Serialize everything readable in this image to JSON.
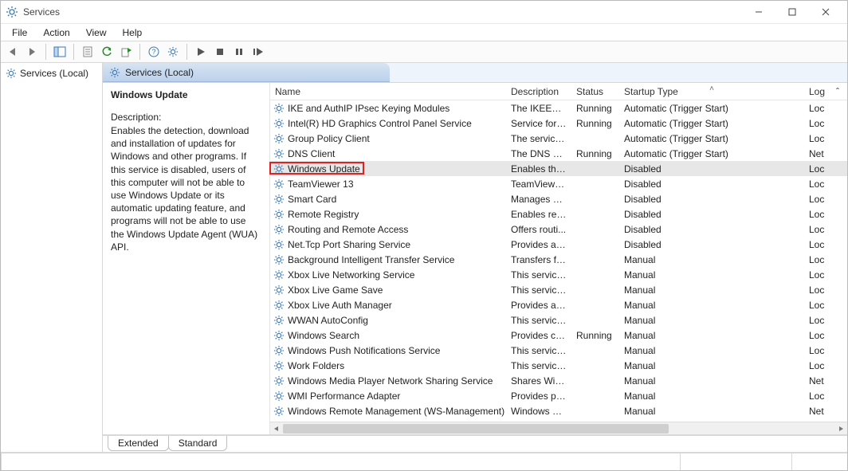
{
  "window": {
    "title": "Services",
    "controls": {
      "min": "—",
      "max": "▢",
      "close": "✕"
    }
  },
  "menus": [
    "File",
    "Action",
    "View",
    "Help"
  ],
  "left_tree": {
    "root_label": "Services (Local)"
  },
  "pane_header": "Services (Local)",
  "detail": {
    "title": "Windows Update",
    "desc_label": "Description:",
    "description": "Enables the detection, download and installation of updates for Windows and other programs. If this service is disabled, users of this computer will not be able to use Windows Update or its automatic updating feature, and programs will not be able to use the Windows Update Agent (WUA) API."
  },
  "columns": {
    "name": "Name",
    "description": "Description",
    "status": "Status",
    "startup": "Startup Type",
    "log": "Log"
  },
  "sort_indicator": "˄",
  "services": [
    {
      "name": "IKE and AuthIP IPsec Keying Modules",
      "desc": "The IKEEXT ...",
      "status": "Running",
      "startup": "Automatic (Trigger Start)",
      "log": "Loc"
    },
    {
      "name": "Intel(R) HD Graphics Control Panel Service",
      "desc": "Service for I...",
      "status": "Running",
      "startup": "Automatic (Trigger Start)",
      "log": "Loc"
    },
    {
      "name": "Group Policy Client",
      "desc": "The service ...",
      "status": "",
      "startup": "Automatic (Trigger Start)",
      "log": "Loc"
    },
    {
      "name": "DNS Client",
      "desc": "The DNS Cli...",
      "status": "Running",
      "startup": "Automatic (Trigger Start)",
      "log": "Net"
    },
    {
      "name": "Windows Update",
      "desc": "Enables the ...",
      "status": "",
      "startup": "Disabled",
      "log": "Loc",
      "selected": true,
      "highlighted": true
    },
    {
      "name": "TeamViewer 13",
      "desc": "TeamViewer...",
      "status": "",
      "startup": "Disabled",
      "log": "Loc"
    },
    {
      "name": "Smart Card",
      "desc": "Manages ac...",
      "status": "",
      "startup": "Disabled",
      "log": "Loc"
    },
    {
      "name": "Remote Registry",
      "desc": "Enables rem...",
      "status": "",
      "startup": "Disabled",
      "log": "Loc"
    },
    {
      "name": "Routing and Remote Access",
      "desc": "Offers routi...",
      "status": "",
      "startup": "Disabled",
      "log": "Loc"
    },
    {
      "name": "Net.Tcp Port Sharing Service",
      "desc": "Provides abi...",
      "status": "",
      "startup": "Disabled",
      "log": "Loc"
    },
    {
      "name": "Background Intelligent Transfer Service",
      "desc": "Transfers fil...",
      "status": "",
      "startup": "Manual",
      "log": "Loc"
    },
    {
      "name": "Xbox Live Networking Service",
      "desc": "This service ...",
      "status": "",
      "startup": "Manual",
      "log": "Loc"
    },
    {
      "name": "Xbox Live Game Save",
      "desc": "This service ...",
      "status": "",
      "startup": "Manual",
      "log": "Loc"
    },
    {
      "name": "Xbox Live Auth Manager",
      "desc": "Provides au...",
      "status": "",
      "startup": "Manual",
      "log": "Loc"
    },
    {
      "name": "WWAN AutoConfig",
      "desc": "This service ...",
      "status": "",
      "startup": "Manual",
      "log": "Loc"
    },
    {
      "name": "Windows Search",
      "desc": "Provides co...",
      "status": "Running",
      "startup": "Manual",
      "log": "Loc"
    },
    {
      "name": "Windows Push Notifications Service",
      "desc": "This service ...",
      "status": "",
      "startup": "Manual",
      "log": "Loc"
    },
    {
      "name": "Work Folders",
      "desc": "This service ...",
      "status": "",
      "startup": "Manual",
      "log": "Loc"
    },
    {
      "name": "Windows Media Player Network Sharing Service",
      "desc": "Shares Win...",
      "status": "",
      "startup": "Manual",
      "log": "Net"
    },
    {
      "name": "WMI Performance Adapter",
      "desc": "Provides pe...",
      "status": "",
      "startup": "Manual",
      "log": "Loc"
    },
    {
      "name": "Windows Remote Management (WS-Management)",
      "desc": "Windows R...",
      "status": "",
      "startup": "Manual",
      "log": "Net"
    }
  ],
  "tabs": {
    "extended": "Extended",
    "standard": "Standard"
  },
  "vscroll_indicator": "ˆ"
}
